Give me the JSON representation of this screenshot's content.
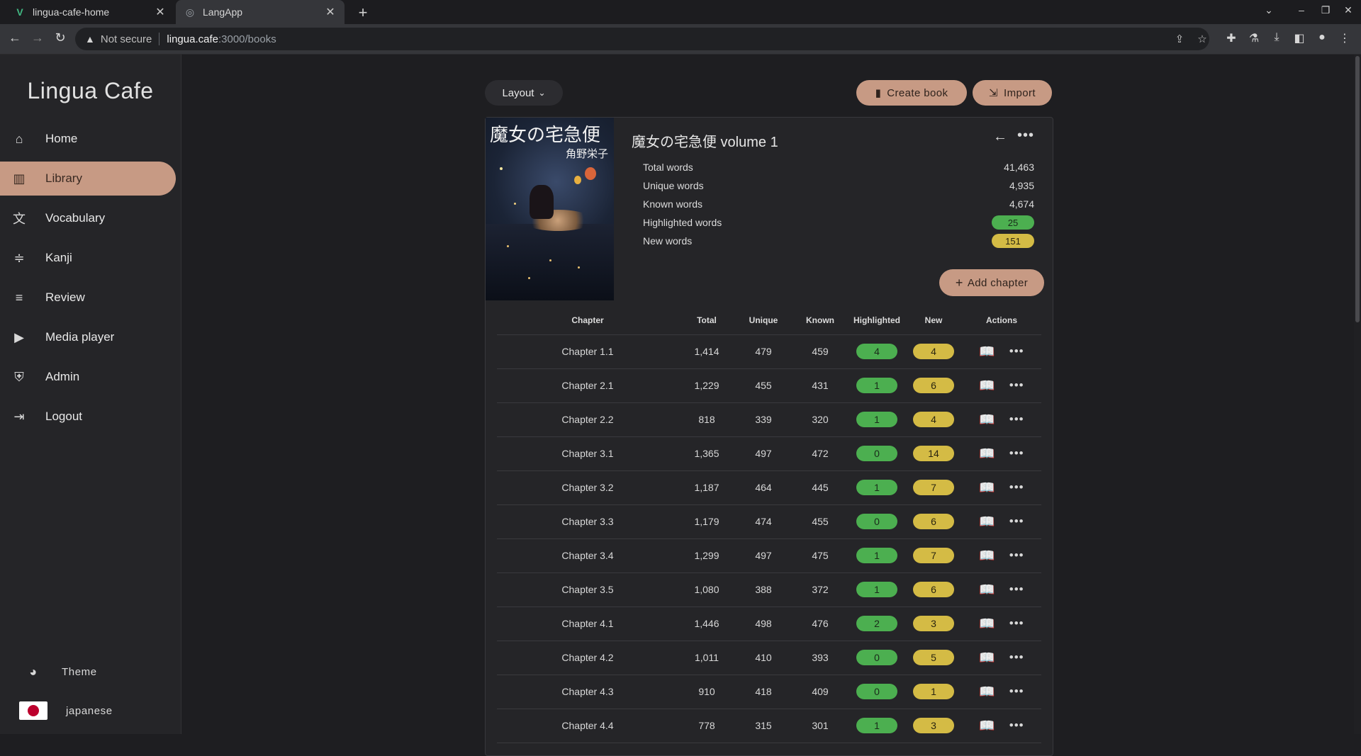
{
  "browser": {
    "tabs": [
      {
        "title": "lingua-cafe-home",
        "icon": "vue-icon"
      },
      {
        "title": "LangApp",
        "icon": "globe-icon"
      }
    ],
    "security_label": "Not secure",
    "url_host": "lingua.cafe",
    "url_path": ":3000/books"
  },
  "sidebar": {
    "brand": "Lingua Cafe",
    "items": [
      {
        "label": "Home",
        "icon": "home-icon"
      },
      {
        "label": "Library",
        "icon": "library-icon",
        "active": true
      },
      {
        "label": "Vocabulary",
        "icon": "translate-icon"
      },
      {
        "label": "Kanji",
        "icon": "kanji-icon"
      },
      {
        "label": "Review",
        "icon": "review-icon"
      },
      {
        "label": "Media player",
        "icon": "media-icon"
      },
      {
        "label": "Admin",
        "icon": "shield-icon"
      },
      {
        "label": "Logout",
        "icon": "logout-icon"
      }
    ],
    "theme_label": "Theme",
    "language_label": "japanese"
  },
  "toolbar": {
    "layout_label": "Layout",
    "create_label": "Create book",
    "import_label": "Import"
  },
  "book": {
    "cover_title": "魔女の宅急便",
    "cover_author": "角野栄子",
    "title": "魔女の宅急便 volume 1",
    "stats": [
      {
        "label": "Total words",
        "value": "41,463"
      },
      {
        "label": "Unique words",
        "value": "4,935"
      },
      {
        "label": "Known words",
        "value": "4,674"
      },
      {
        "label": "Highlighted words",
        "value": "25"
      },
      {
        "label": "New words",
        "value": "151"
      }
    ],
    "add_chapter_label": "Add chapter"
  },
  "table": {
    "headers": [
      "Chapter",
      "Total",
      "Unique",
      "Known",
      "Highlighted",
      "New",
      "Actions"
    ],
    "rows": [
      {
        "chapter": "Chapter 1.1",
        "total": "1,414",
        "unique": "479",
        "known": "459",
        "highlighted": "4",
        "new": "4"
      },
      {
        "chapter": "Chapter 2.1",
        "total": "1,229",
        "unique": "455",
        "known": "431",
        "highlighted": "1",
        "new": "6"
      },
      {
        "chapter": "Chapter 2.2",
        "total": "818",
        "unique": "339",
        "known": "320",
        "highlighted": "1",
        "new": "4"
      },
      {
        "chapter": "Chapter 3.1",
        "total": "1,365",
        "unique": "497",
        "known": "472",
        "highlighted": "0",
        "new": "14"
      },
      {
        "chapter": "Chapter 3.2",
        "total": "1,187",
        "unique": "464",
        "known": "445",
        "highlighted": "1",
        "new": "7"
      },
      {
        "chapter": "Chapter 3.3",
        "total": "1,179",
        "unique": "474",
        "known": "455",
        "highlighted": "0",
        "new": "6"
      },
      {
        "chapter": "Chapter 3.4",
        "total": "1,299",
        "unique": "497",
        "known": "475",
        "highlighted": "1",
        "new": "7"
      },
      {
        "chapter": "Chapter 3.5",
        "total": "1,080",
        "unique": "388",
        "known": "372",
        "highlighted": "1",
        "new": "6"
      },
      {
        "chapter": "Chapter 4.1",
        "total": "1,446",
        "unique": "498",
        "known": "476",
        "highlighted": "2",
        "new": "3"
      },
      {
        "chapter": "Chapter 4.2",
        "total": "1,011",
        "unique": "410",
        "known": "393",
        "highlighted": "0",
        "new": "5"
      },
      {
        "chapter": "Chapter 4.3",
        "total": "910",
        "unique": "418",
        "known": "409",
        "highlighted": "0",
        "new": "1"
      },
      {
        "chapter": "Chapter 4.4",
        "total": "778",
        "unique": "315",
        "known": "301",
        "highlighted": "1",
        "new": "3"
      }
    ]
  },
  "colors": {
    "accent": "#c79a84",
    "highlighted": "#4caf50",
    "new": "#d4bb45"
  }
}
